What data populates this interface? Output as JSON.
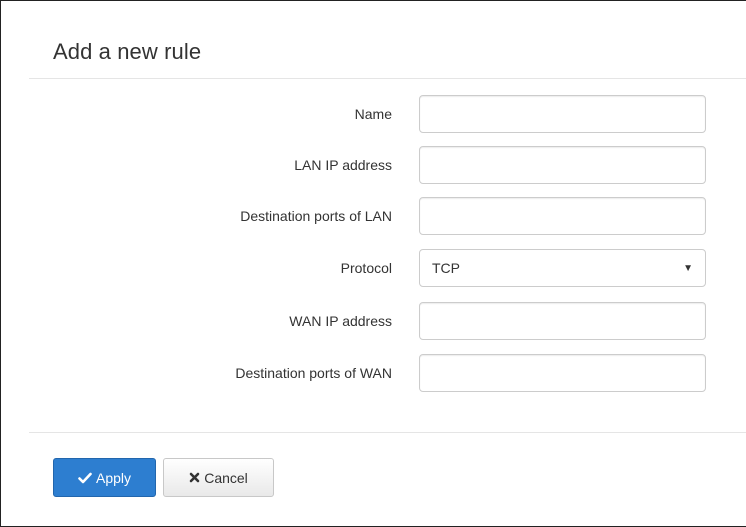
{
  "dialog": {
    "title": "Add a new rule"
  },
  "form": {
    "fields": [
      {
        "label": "Name",
        "value": ""
      },
      {
        "label": "LAN IP address",
        "value": ""
      },
      {
        "label": "Destination ports of LAN",
        "value": ""
      },
      {
        "label": "Protocol",
        "value": "TCP",
        "type": "select"
      },
      {
        "label": "WAN IP address",
        "value": ""
      },
      {
        "label": "Destination ports of WAN",
        "value": ""
      }
    ]
  },
  "buttons": {
    "apply_label": "Apply",
    "apply_icon": "check-icon",
    "cancel_label": "Cancel",
    "cancel_icon": "close-icon"
  },
  "colors": {
    "primary": "#2d7ed0",
    "text": "#333333",
    "border": "#cccccc"
  }
}
